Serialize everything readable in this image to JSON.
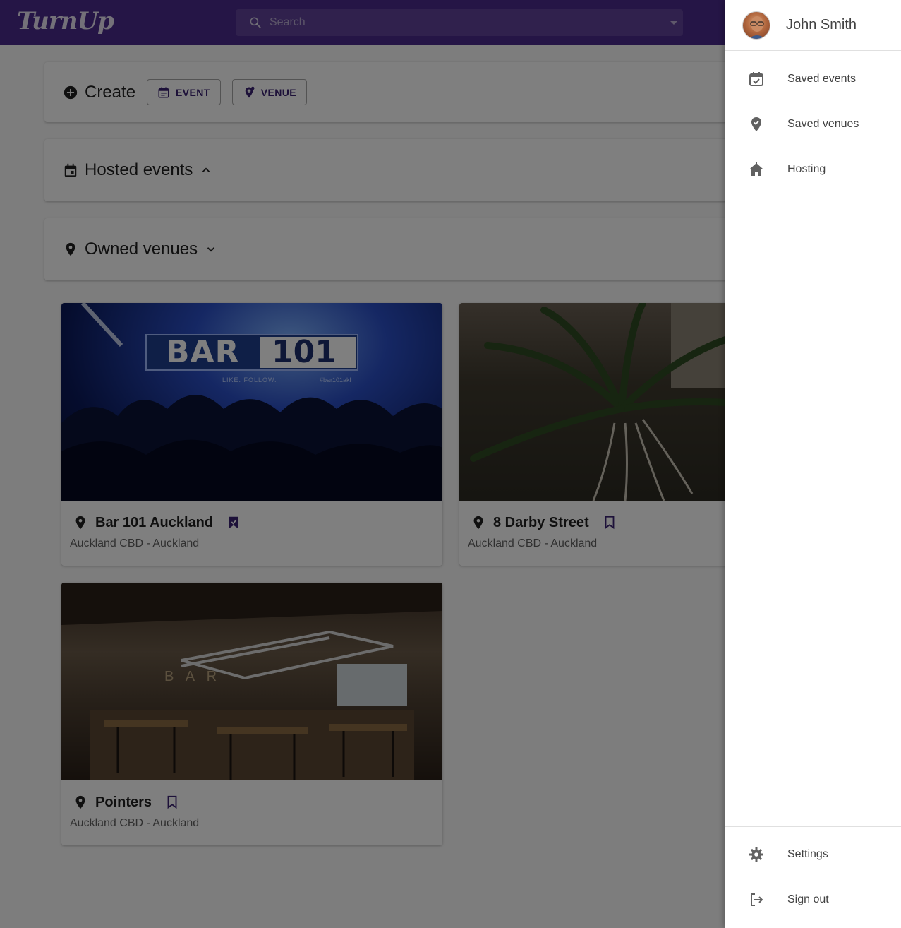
{
  "app": {
    "logo": "TurnUp"
  },
  "search": {
    "placeholder": "Search"
  },
  "create": {
    "label": "Create",
    "event_button": "EVENT",
    "venue_button": "VENUE"
  },
  "hosted_events": {
    "title": "Hosted events"
  },
  "owned_venues": {
    "title": "Owned venues"
  },
  "venues": [
    {
      "name": "Bar 101 Auckland",
      "location": "Auckland CBD - Auckland",
      "saved": true,
      "image_text": {
        "sign": "BAR 101",
        "tagline": "LIKE. FOLLOW.",
        "hashtag": "#bar101akl"
      }
    },
    {
      "name": "8 Darby Street",
      "location": "Auckland CBD - Auckland",
      "saved": false
    },
    {
      "name": "Pointers",
      "location": "Auckland CBD - Auckland",
      "saved": false,
      "image_text": {
        "sign": "B A R"
      }
    }
  ],
  "drawer": {
    "user_name": "John Smith",
    "items": [
      {
        "label": "Saved events",
        "icon": "event-available-icon"
      },
      {
        "label": "Saved venues",
        "icon": "place-check-icon"
      },
      {
        "label": "Hosting",
        "icon": "house-icon"
      }
    ],
    "footer": [
      {
        "label": "Settings",
        "icon": "gear-icon"
      },
      {
        "label": "Sign out",
        "icon": "exit-icon"
      }
    ]
  },
  "colors": {
    "primary": "#4a2a8c",
    "accent": "#3b2272"
  }
}
